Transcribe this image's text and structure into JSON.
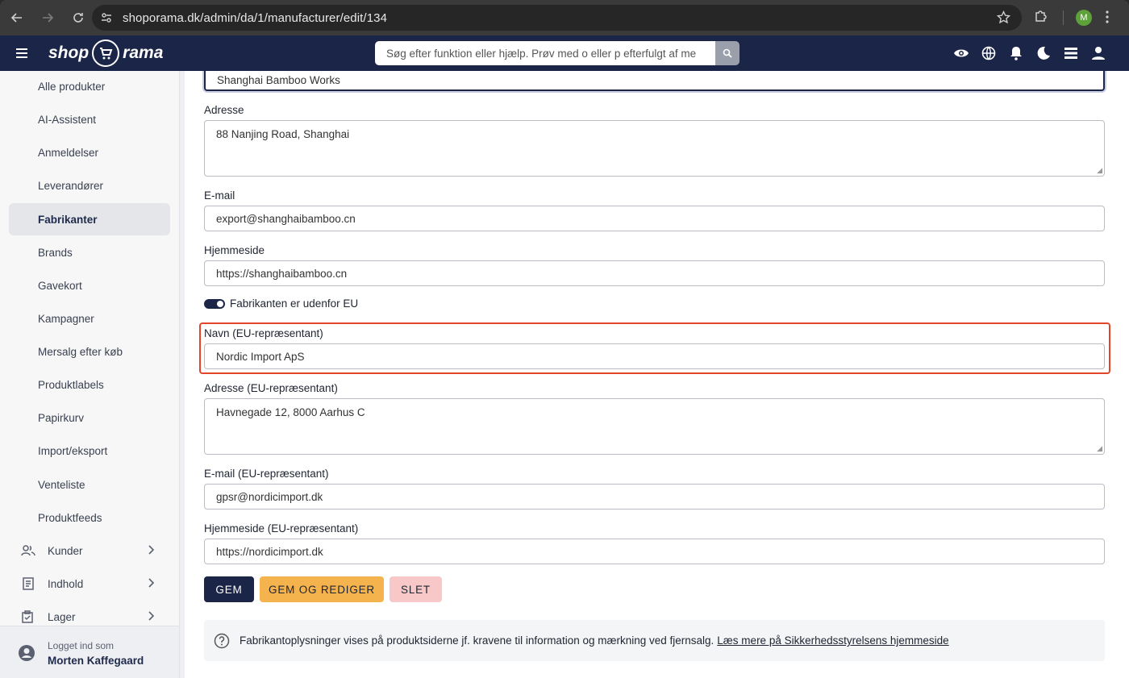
{
  "browser": {
    "url": "shoporama.dk/admin/da/1/manufacturer/edit/134",
    "profile_initial": "M"
  },
  "header": {
    "logo_left": "shop",
    "logo_right": "rama",
    "search_placeholder": "Søg efter funktion eller hjælp. Prøv med o eller p efterfulgt af me"
  },
  "sidebar": {
    "items": [
      {
        "label": "Alle produkter"
      },
      {
        "label": "AI-Assistent"
      },
      {
        "label": "Anmeldelser"
      },
      {
        "label": "Leverandører"
      },
      {
        "label": "Fabrikanter",
        "active": true
      },
      {
        "label": "Brands"
      },
      {
        "label": "Gavekort"
      },
      {
        "label": "Kampagner"
      },
      {
        "label": "Mersalg efter køb"
      },
      {
        "label": "Produktlabels"
      },
      {
        "label": "Papirkurv"
      },
      {
        "label": "Import/eksport"
      },
      {
        "label": "Venteliste"
      },
      {
        "label": "Produktfeeds"
      }
    ],
    "groups": [
      {
        "label": "Kunder",
        "icon": "people-icon"
      },
      {
        "label": "Indhold",
        "icon": "document-icon"
      },
      {
        "label": "Lager",
        "icon": "clipboard-icon"
      }
    ],
    "user": {
      "label": "Logget ind som",
      "name": "Morten Kaffegaard"
    }
  },
  "form": {
    "name_value": "Shanghai Bamboo Works",
    "address_label": "Adresse",
    "address_value": "88 Nanjing Road, Shanghai",
    "email_label": "E-mail",
    "email_value": "export@shanghaibamboo.cn",
    "website_label": "Hjemmeside",
    "website_value": "https://shanghaibamboo.cn",
    "outside_eu_label": "Fabrikanten er udenfor EU",
    "outside_eu_checked": true,
    "eu_name_label": "Navn (EU-repræsentant)",
    "eu_name_value": "Nordic Import ApS",
    "eu_address_label": "Adresse (EU-repræsentant)",
    "eu_address_value": "Havnegade 12, 8000 Aarhus C",
    "eu_email_label": "E-mail (EU-repræsentant)",
    "eu_email_value": "gpsr@nordicimport.dk",
    "eu_website_label": "Hjemmeside (EU-repræsentant)",
    "eu_website_value": "https://nordicimport.dk"
  },
  "buttons": {
    "save": "GEM",
    "save_edit": "GEM OG REDIGER",
    "delete": "SLET"
  },
  "info": {
    "text": "Fabrikantoplysninger vises på produktsiderne jf. kravene til information og mærkning ved fjernsalg.",
    "link": "Læs mere på Sikkerhedsstyrelsens hjemmeside"
  }
}
